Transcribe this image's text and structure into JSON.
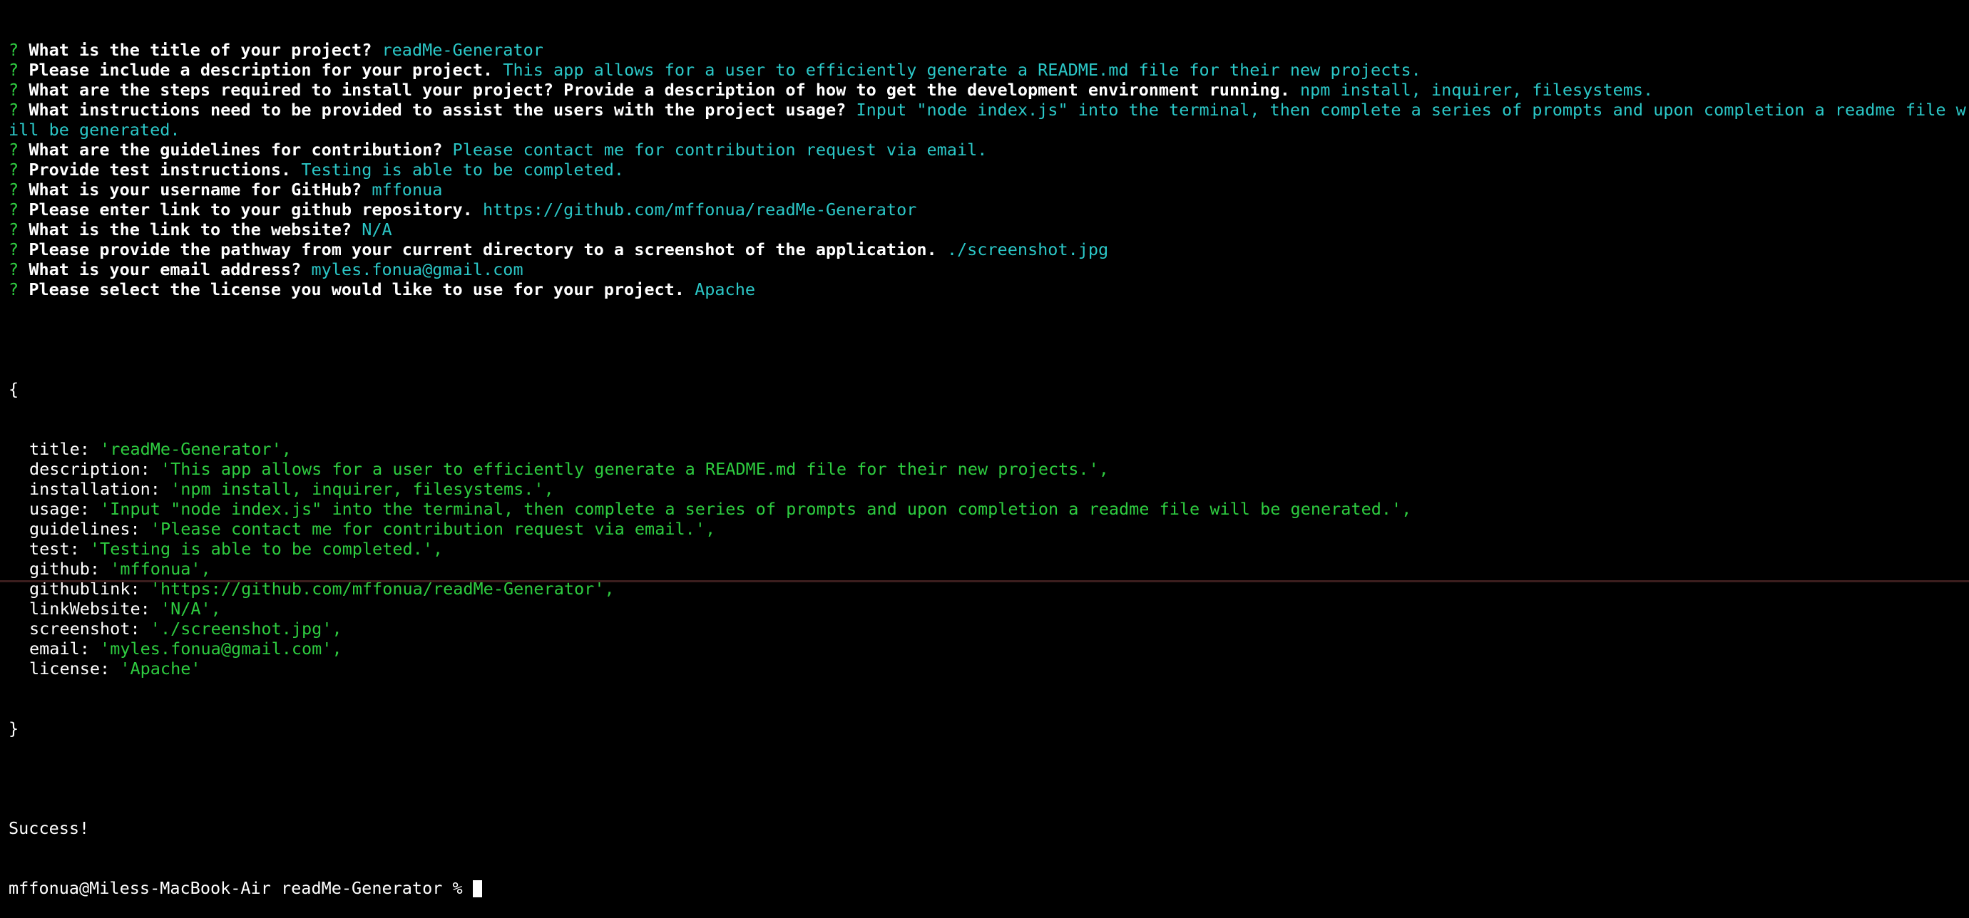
{
  "prompts": [
    {
      "q": "What is the title of your project?",
      "a": "readMe-Generator"
    },
    {
      "q": "Please include a description for your project.",
      "a": "This app allows for a user to efficiently generate a README.md file for their new projects."
    },
    {
      "q": "What are the steps required to install your project? Provide a description of how to get the development environment running.",
      "a": "npm install, inquirer, filesystems."
    },
    {
      "q": "What instructions need to be provided to assist the users with the project usage?",
      "a": "Input \"node index.js\" into the terminal, then complete a series of prompts and upon completion a readme file will be generated."
    },
    {
      "q": "What are the guidelines for contribution?",
      "a": "Please contact me for contribution request via email."
    },
    {
      "q": "Provide test instructions.",
      "a": "Testing is able to be completed."
    },
    {
      "q": "What is your username for GitHub?",
      "a": "mffonua"
    },
    {
      "q": "Please enter link to your github repository.",
      "a": "https://github.com/mffonua/readMe-Generator"
    },
    {
      "q": "What is the link to the website?",
      "a": "N/A"
    },
    {
      "q": "Please provide the pathway from your current directory to a screenshot of the application.",
      "a": "./screenshot.jpg"
    },
    {
      "q": "What is your email address?",
      "a": "myles.fonua@gmail.com"
    },
    {
      "q": "Please select the license you would like to use for your project.",
      "a": "Apache"
    }
  ],
  "qmark": "?",
  "object": {
    "open": "{",
    "close": "}",
    "fields": [
      {
        "key": "title:",
        "val": "'readMe-Generator',"
      },
      {
        "key": "description:",
        "val": "'This app allows for a user to efficiently generate a README.md file for their new projects.',"
      },
      {
        "key": "installation:",
        "val": "'npm install, inquirer, filesystems.',"
      },
      {
        "key": "usage:",
        "val": "'Input \"node index.js\" into the terminal, then complete a series of prompts and upon completion a readme file will be generated.',"
      },
      {
        "key": "guidelines:",
        "val": "'Please contact me for contribution request via email.',"
      },
      {
        "key": "test:",
        "val": "'Testing is able to be completed.',"
      },
      {
        "key": "github:",
        "val": "'mffonua',"
      },
      {
        "key": "githublink:",
        "val": "'https://github.com/mffonua/readMe-Generator',"
      },
      {
        "key": "linkWebsite:",
        "val": "'N/A',"
      },
      {
        "key": "screenshot:",
        "val": "'./screenshot.jpg',"
      },
      {
        "key": "email:",
        "val": "'myles.fonua@gmail.com',"
      },
      {
        "key": "license:",
        "val": "'Apache'"
      }
    ]
  },
  "status": "Success!",
  "shell_prompt": "mffonua@Miless-MacBook-Air readMe-Generator % ",
  "colors": {
    "background": "#000000",
    "question_mark": "#2ecc40",
    "answer": "#2bc7c7",
    "object_value": "#2ecc40",
    "text": "#ffffff"
  }
}
